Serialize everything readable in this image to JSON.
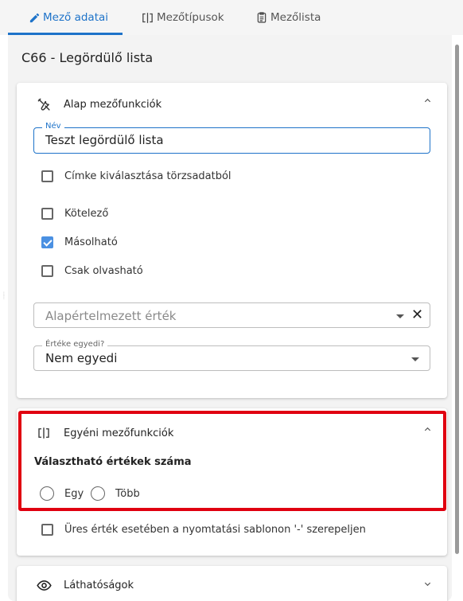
{
  "tabs": [
    {
      "label": "Mező adatai",
      "icon": "pencil-icon",
      "active": true
    },
    {
      "label": "Mezőtípusok",
      "icon": "field-type-icon",
      "active": false
    },
    {
      "label": "Mezőlista",
      "icon": "list-icon",
      "active": false
    }
  ],
  "page_title": "C66 - Legördülő lista",
  "basic_section": {
    "title": "Alap mezőfunkciók",
    "icon": "tools-icon",
    "name_field": {
      "label": "Név",
      "value": "Teszt legördülő lista"
    },
    "label_from_master": {
      "label": "Címke kiválasztása törzsadatból",
      "checked": false
    },
    "checkboxes": [
      {
        "label": "Kötelező",
        "checked": false
      },
      {
        "label": "Másolható",
        "checked": true
      },
      {
        "label": "Csak olvasható",
        "checked": false
      }
    ],
    "default_value": {
      "placeholder": "Alapértelmezett érték"
    },
    "unique_value": {
      "label": "Értéke egyedi?",
      "value": "Nem egyedi"
    }
  },
  "custom_section": {
    "title": "Egyéni mezőfunkciók",
    "icon": "field-type-icon",
    "subtitle": "Választható értékek száma",
    "options": [
      {
        "label": "Egy",
        "selected": false
      },
      {
        "label": "Több",
        "selected": false
      }
    ],
    "empty_value_option": {
      "label": "Üres érték esetében a nyomtatási sablonon '-' szerepeljen",
      "checked": false
    }
  },
  "visibility_section": {
    "title": "Láthatóságok",
    "icon": "eye-icon"
  },
  "colors": {
    "accent": "#1e73c9",
    "checkbox_checked": "#4a90e2",
    "highlight": "#e00010"
  }
}
